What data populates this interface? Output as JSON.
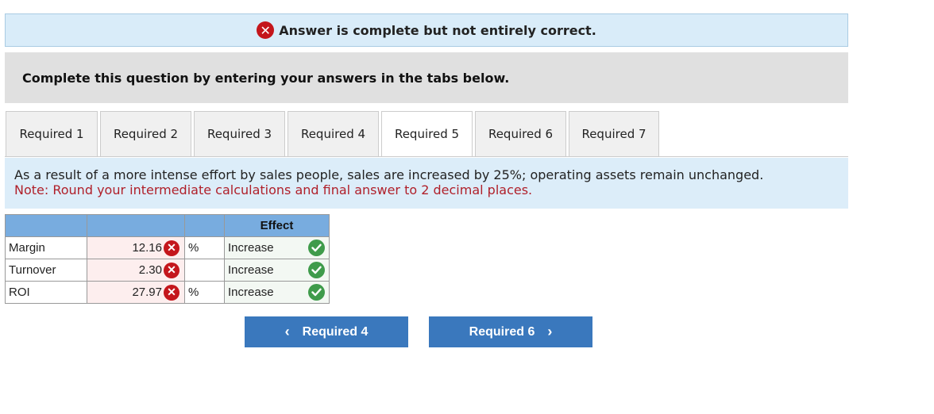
{
  "banner": {
    "text": "Answer is complete but not entirely correct.",
    "icon": "x-circle-icon"
  },
  "instructions": "Complete this question by entering your answers in the tabs below.",
  "tabs": [
    {
      "label": "Required 1",
      "active": false
    },
    {
      "label": "Required 2",
      "active": false
    },
    {
      "label": "Required 3",
      "active": false
    },
    {
      "label": "Required 4",
      "active": false
    },
    {
      "label": "Required 5",
      "active": true
    },
    {
      "label": "Required 6",
      "active": false
    },
    {
      "label": "Required 7",
      "active": false
    }
  ],
  "question": {
    "text": "As a result of a more intense effort by sales people, sales are increased by 25%; operating assets remain unchanged.",
    "note": "Note: Round your intermediate calculations and final answer to 2 decimal places."
  },
  "table": {
    "effect_header": "Effect",
    "rows": [
      {
        "label": "Margin",
        "value": "12.16",
        "value_status": "incorrect",
        "unit": "%",
        "effect": "Increase",
        "effect_status": "correct"
      },
      {
        "label": "Turnover",
        "value": "2.30",
        "value_status": "incorrect",
        "unit": "",
        "effect": "Increase",
        "effect_status": "correct"
      },
      {
        "label": "ROI",
        "value": "27.97",
        "value_status": "incorrect",
        "unit": "%",
        "effect": "Increase",
        "effect_status": "correct"
      }
    ]
  },
  "nav": {
    "prev_label": "Required 4",
    "prev_icon": "chevron-left-icon",
    "next_label": "Required 6",
    "next_icon": "chevron-right-icon"
  },
  "colors": {
    "banner_bg": "#d9ecf9",
    "error_red": "#c4161c",
    "correct_green": "#3f9b4b",
    "button_blue": "#3a78bd",
    "header_blue": "#78acdf",
    "note_red": "#b0202a"
  }
}
